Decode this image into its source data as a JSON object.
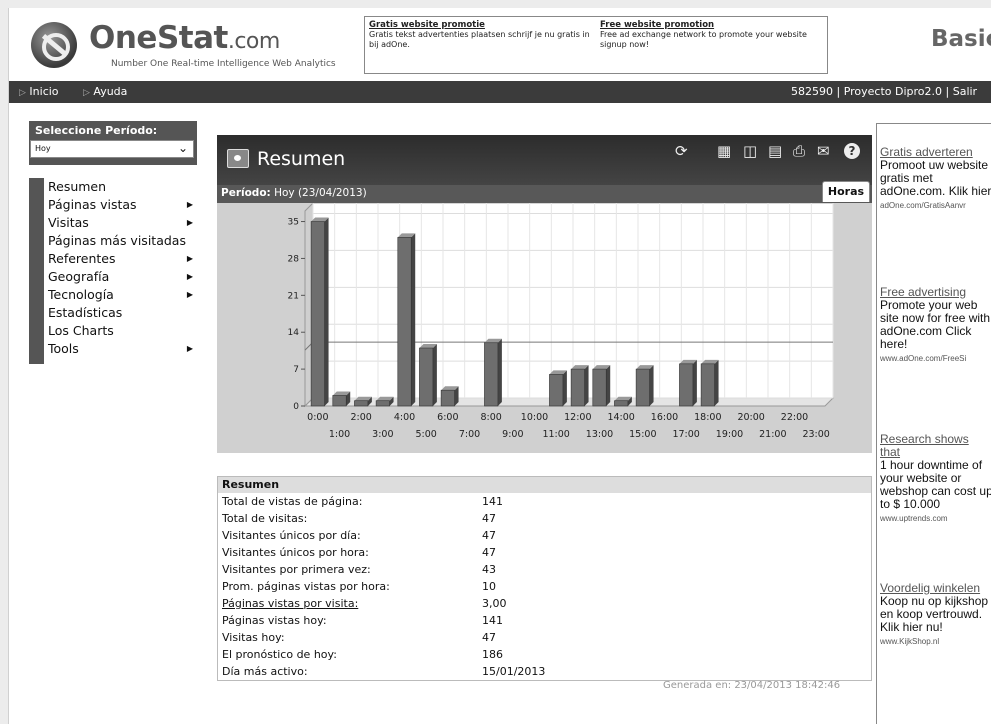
{
  "brand": {
    "name": "OneStat",
    "suffix": ".com",
    "tagline": "Number One Real-time Intelligence Web Analytics",
    "edition": "Basic"
  },
  "promo": [
    {
      "title": "Gratis website promotie",
      "text": "Gratis tekst advertenties plaatsen schrijf je nu gratis in bij adOne."
    },
    {
      "title": "Free website promotion",
      "text": "Free ad exchange network to promote your website signup now!"
    }
  ],
  "nav": {
    "items": [
      "Inicio",
      "Ayuda"
    ],
    "right": "582590 | Proyecto Dipro2.0 | Salir"
  },
  "sidebar": {
    "period_label": "Seleccione Período:",
    "period_value": "Hoy",
    "menu": [
      {
        "label": "Resumen",
        "sub": false
      },
      {
        "label": "Páginas vistas",
        "sub": true
      },
      {
        "label": "Visitas",
        "sub": true
      },
      {
        "label": "Páginas más visitadas",
        "sub": false
      },
      {
        "label": "Referentes",
        "sub": true
      },
      {
        "label": "Geografía",
        "sub": true
      },
      {
        "label": "Tecnología",
        "sub": true
      },
      {
        "label": "Estadísticas",
        "sub": false
      },
      {
        "label": "Los Charts",
        "sub": false
      },
      {
        "label": "Tools",
        "sub": true
      }
    ]
  },
  "panel": {
    "title": "Resumen",
    "period_label": "Período:",
    "period_value": "Hoy (23/04/2013)",
    "tab": "Horas",
    "icons": [
      "refresh-icon",
      "excel-icon",
      "pdf-icon",
      "xml-icon",
      "print-icon",
      "mail-icon",
      "help-icon"
    ]
  },
  "chart_data": {
    "type": "bar",
    "categories": [
      "0:00",
      "1:00",
      "2:00",
      "3:00",
      "4:00",
      "5:00",
      "6:00",
      "7:00",
      "8:00",
      "9:00",
      "10:00",
      "11:00",
      "12:00",
      "13:00",
      "14:00",
      "15:00",
      "16:00",
      "17:00",
      "18:00",
      "19:00",
      "20:00",
      "21:00",
      "22:00",
      "23:00"
    ],
    "values": [
      35,
      2,
      1,
      1,
      32,
      11,
      3,
      0,
      12,
      0,
      0,
      6,
      7,
      7,
      1,
      7,
      0,
      8,
      8,
      0,
      0,
      0,
      0,
      0
    ],
    "yticks": [
      0,
      7,
      14,
      21,
      28,
      35
    ],
    "ylim": [
      0,
      37
    ],
    "average_line": 10.6,
    "grid": true,
    "bar_color": "#6e6e6e"
  },
  "summary": {
    "header": "Resumen",
    "rows": [
      {
        "k": "Total de vistas de página:",
        "v": "141"
      },
      {
        "k": "Total de visitas:",
        "v": "47"
      },
      {
        "k": "Visitantes únicos por día:",
        "v": "47"
      },
      {
        "k": "Visitantes únicos por hora:",
        "v": "47"
      },
      {
        "k": "Visitantes por primera vez:",
        "v": "43"
      },
      {
        "k": "Prom. páginas vistas por hora:",
        "v": "10"
      },
      {
        "k": "Páginas vistas por visita:",
        "v": "3,00",
        "link": true
      },
      {
        "k": "Páginas vistas hoy:",
        "v": "141"
      },
      {
        "k": "Visitas hoy:",
        "v": "47"
      },
      {
        "k": "El pronóstico de hoy:",
        "v": "186"
      },
      {
        "k": "Día más activo:",
        "v": "15/01/2013"
      }
    ],
    "generated": "Generada en: 23/04/2013 18:42:46"
  },
  "ads": [
    {
      "title": "Gratis adverteren",
      "body": "Promoot uw website\ngratis met\nadOne.com. Klik hier",
      "url": "adOne.com/GratisAanvr"
    },
    {
      "title": "Free advertising",
      "body": "Promote your web\nsite now for free with\nadOne.com Click\nhere!",
      "url": "www.adOne.com/FreeSi"
    },
    {
      "title": "Research shows\nthat",
      "body": "1 hour downtime of\nyour website or\nwebshop can cost up\nto $ 10.000",
      "url": "www.uptrends.com"
    },
    {
      "title": "Voordelig winkelen",
      "body": "Koop nu op kijkshop\nen koop vertrouwd.\nKlik hier nu!",
      "url": "www.KijkShop.nl"
    }
  ]
}
